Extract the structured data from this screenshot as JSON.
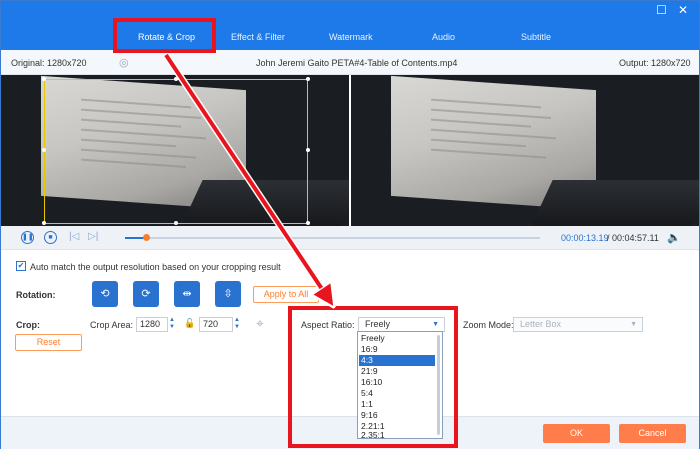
{
  "tabs": [
    "Rotate & Crop",
    "Effect & Filter",
    "Watermark",
    "Audio",
    "Subtitle"
  ],
  "info": {
    "original": "Original: 1280x720",
    "filename": "John Jeremi Gaito PETA#4-Table of Contents.mp4",
    "output": "Output: 1280x720"
  },
  "player": {
    "current_time": "00:00:13.19",
    "separator": "/",
    "total_time": "00:04:57.11",
    "progress": 0.05
  },
  "auto_match": {
    "checked": true,
    "label": "Auto match the output resolution based on your cropping result"
  },
  "rotation": {
    "label": "Rotation:",
    "apply_all": "Apply to All"
  },
  "crop": {
    "label": "Crop:",
    "area_label": "Crop Area:",
    "width": "1280",
    "height": "720",
    "reset": "Reset",
    "aspect_label": "Aspect Ratio:",
    "aspect_value": "Freely",
    "zoom_label": "Zoom Mode:",
    "zoom_value": "Letter Box"
  },
  "aspect_options": [
    "Freely",
    "16:9",
    "4:3",
    "21:9",
    "16:10",
    "5:4",
    "1:1",
    "9:16",
    "2.21:1",
    "2.35:1"
  ],
  "aspect_selected_index": 2,
  "footer": {
    "ok": "OK",
    "cancel": "Cancel"
  },
  "colors": {
    "accent": "#1e7ae8",
    "orange": "#ff7d4a",
    "highlight": "#e8141e"
  }
}
